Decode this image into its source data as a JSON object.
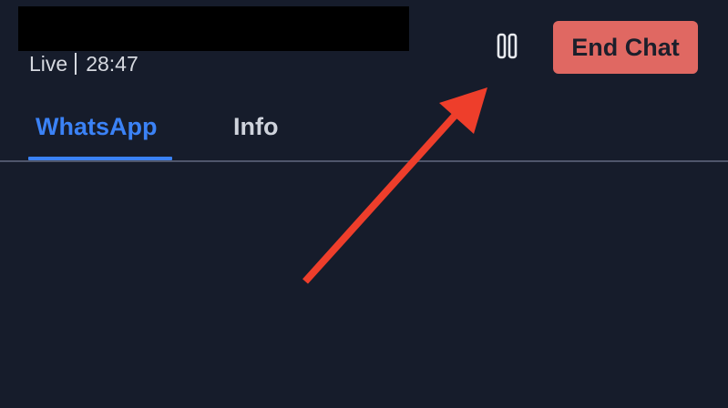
{
  "header": {
    "status_label": "Live",
    "elapsed_time": "28:47",
    "end_chat_label": "End Chat",
    "pause_icon": "pause-icon"
  },
  "tabs": [
    {
      "label": "WhatsApp",
      "active": true
    },
    {
      "label": "Info",
      "active": false
    }
  ],
  "colors": {
    "background": "#161c2b",
    "accent": "#3b82f6",
    "end_chat": "#e06862",
    "annotation_arrow": "#ee3e2b"
  }
}
